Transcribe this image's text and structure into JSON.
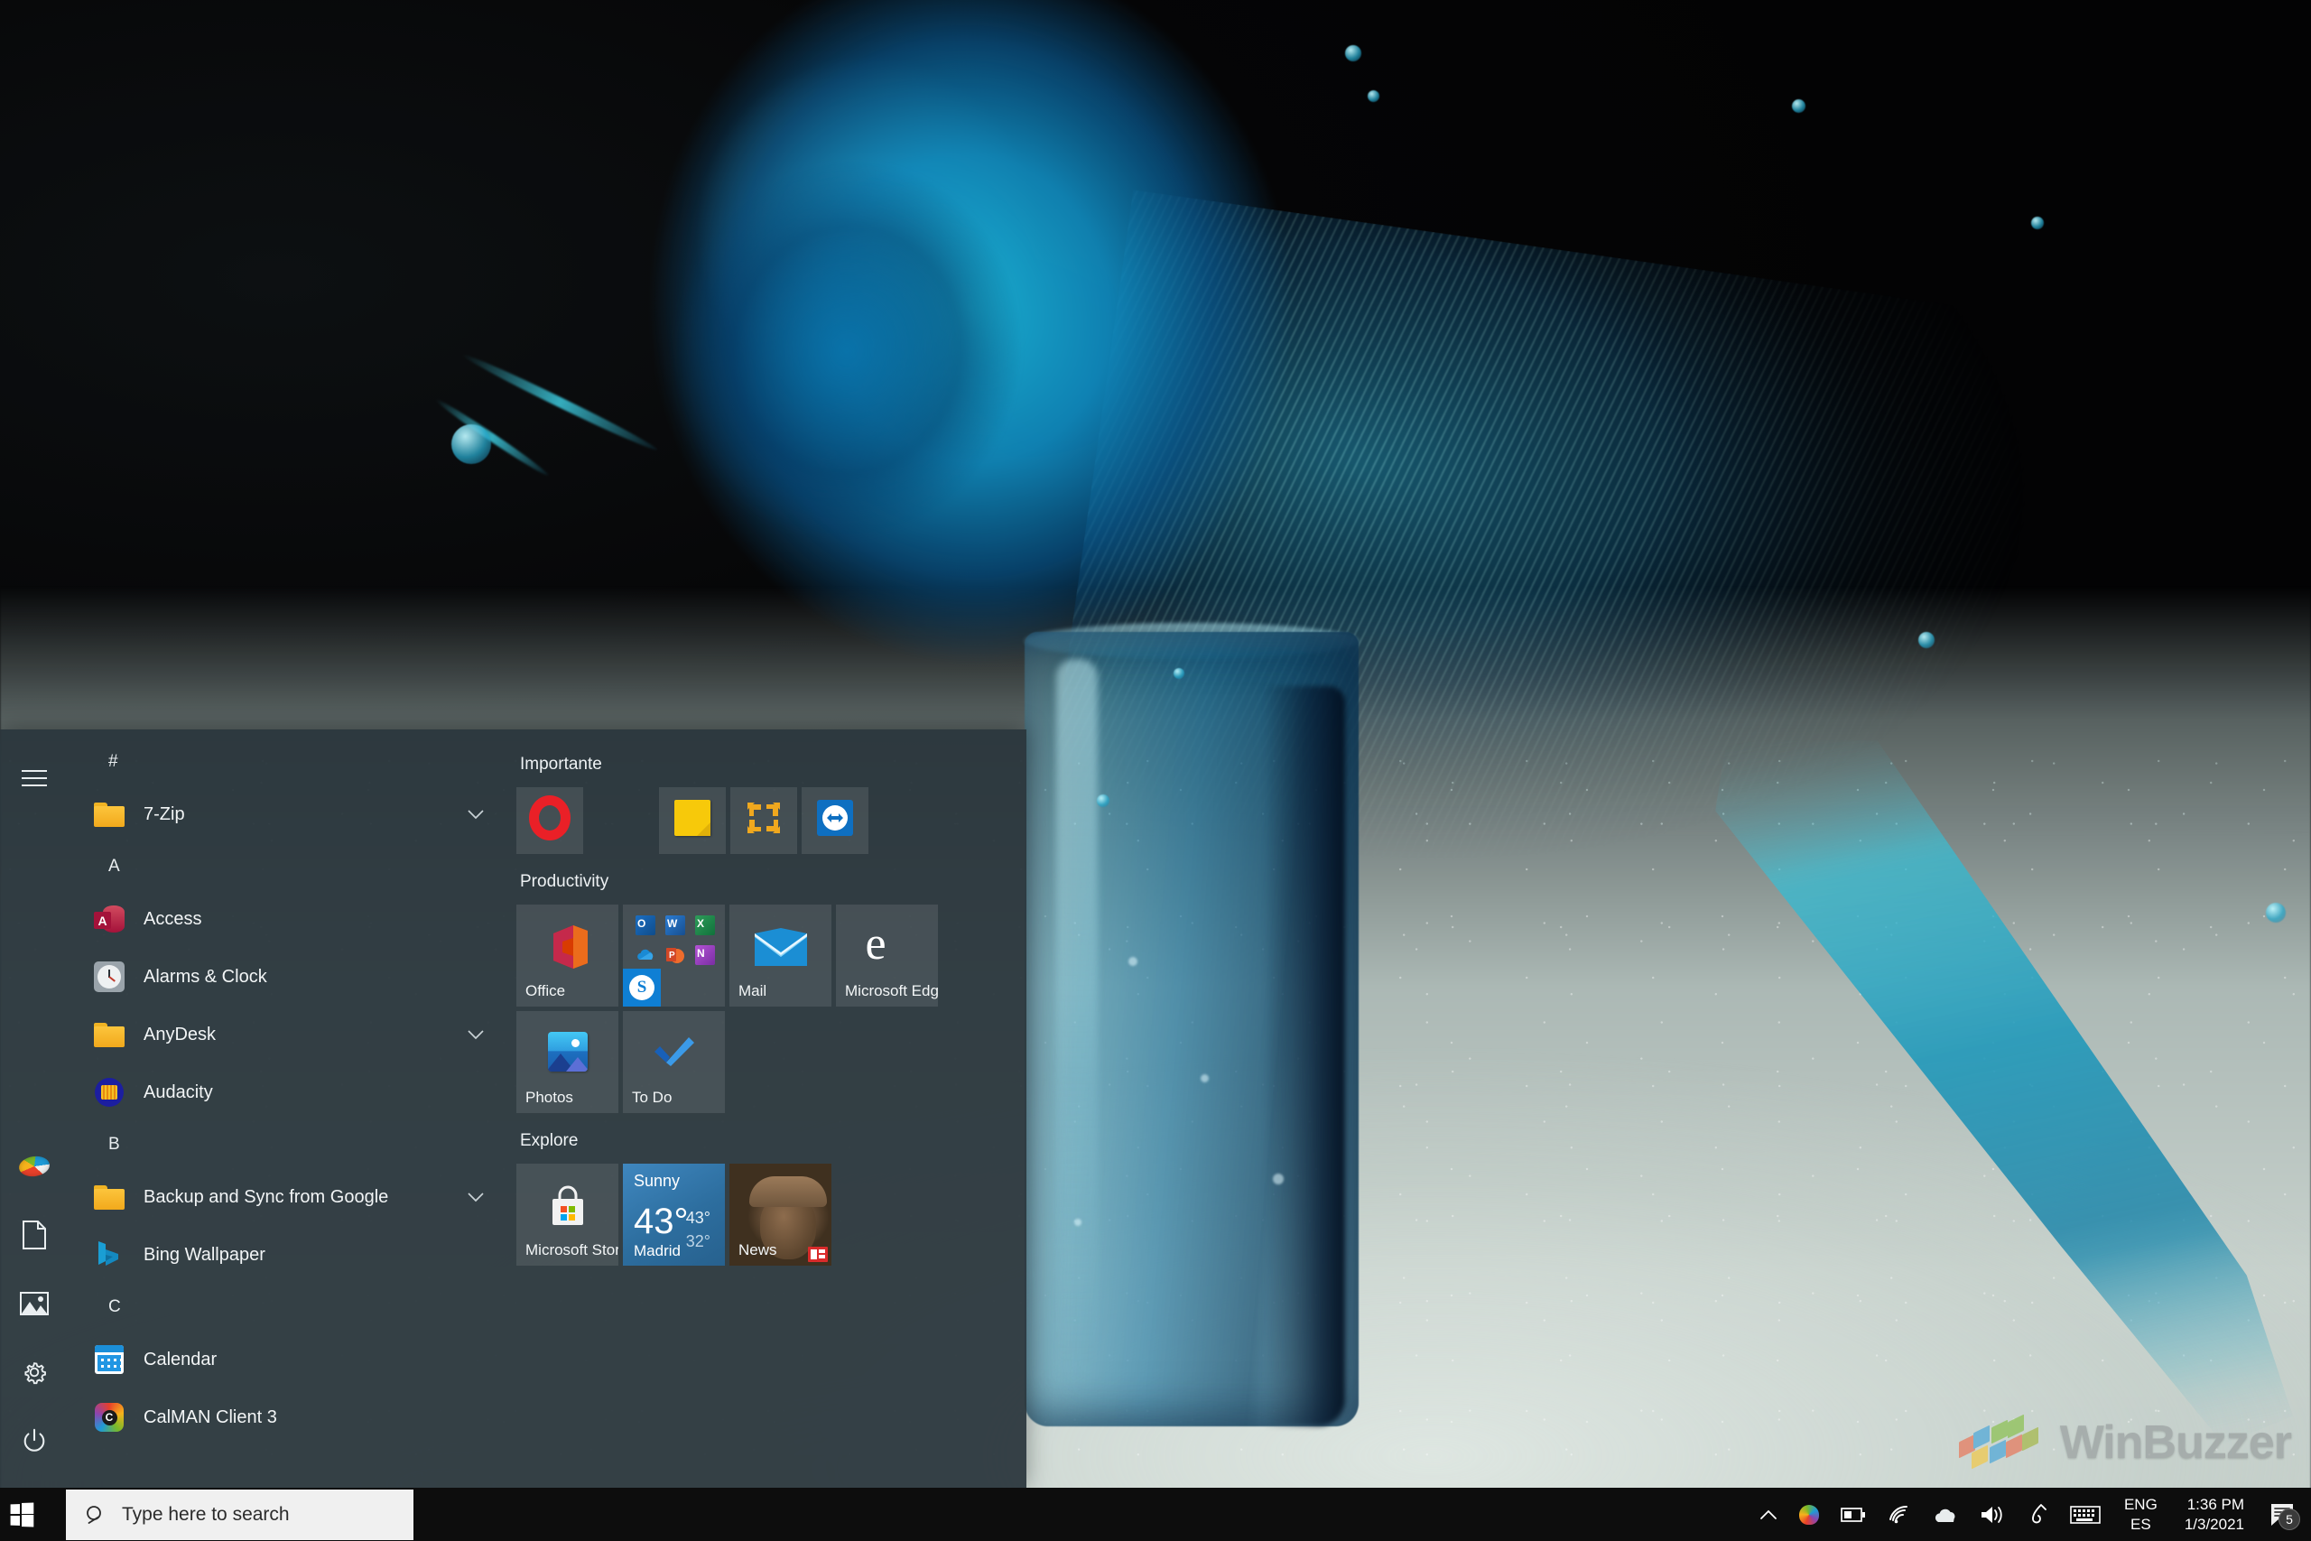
{
  "desktop": {
    "wallpaper_description": "Blue water splash over a glass on icy ground",
    "watermark": {
      "text": "WinBuzzer",
      "logo_icon": "winbuzzer-cubes-logo"
    }
  },
  "start_menu": {
    "rail": [
      {
        "label": "Expand",
        "icon": "hamburger-menu-icon",
        "name": "rail-hamburger"
      },
      {
        "label": "User account",
        "icon": "user-avatar-icon",
        "name": "rail-account"
      },
      {
        "label": "Documents",
        "icon": "documents-icon",
        "name": "rail-documents"
      },
      {
        "label": "Pictures",
        "icon": "pictures-icon",
        "name": "rail-pictures"
      },
      {
        "label": "Settings",
        "icon": "gear-icon",
        "name": "rail-settings"
      },
      {
        "label": "Power",
        "icon": "power-icon",
        "name": "rail-power"
      }
    ],
    "app_list": [
      {
        "type": "letter",
        "label": "#"
      },
      {
        "type": "app",
        "label": "7-Zip",
        "icon": "folder-icon",
        "expandable": true
      },
      {
        "type": "letter",
        "label": "A"
      },
      {
        "type": "app",
        "label": "Access",
        "icon": "access-icon",
        "expandable": false
      },
      {
        "type": "app",
        "label": "Alarms & Clock",
        "icon": "alarms-clock-icon",
        "expandable": false
      },
      {
        "type": "app",
        "label": "AnyDesk",
        "icon": "folder-icon",
        "expandable": true
      },
      {
        "type": "app",
        "label": "Audacity",
        "icon": "audacity-icon",
        "expandable": false
      },
      {
        "type": "letter",
        "label": "B"
      },
      {
        "type": "app",
        "label": "Backup and Sync from Google",
        "icon": "folder-icon",
        "expandable": true
      },
      {
        "type": "app",
        "label": "Bing Wallpaper",
        "icon": "bing-icon",
        "expandable": false
      },
      {
        "type": "letter",
        "label": "C"
      },
      {
        "type": "app",
        "label": "Calendar",
        "icon": "calendar-icon",
        "expandable": false
      },
      {
        "type": "app",
        "label": "CalMAN Client 3",
        "icon": "calman-icon",
        "expandable": false
      }
    ],
    "tile_groups": [
      {
        "title": "Importante",
        "tiles": [
          {
            "size": "sm",
            "icon": "opera-icon",
            "name": ""
          },
          {
            "size": "gap",
            "icon": "",
            "name": ""
          },
          {
            "size": "sm",
            "icon": "sticky-notes-icon",
            "name": ""
          },
          {
            "size": "sm",
            "icon": "vmware-icon",
            "name": ""
          },
          {
            "size": "sm",
            "icon": "teamviewer-icon",
            "name": ""
          }
        ]
      },
      {
        "title": "Productivity",
        "tiles": [
          {
            "size": "md",
            "icon": "office-icon",
            "name": "Office"
          },
          {
            "size": "md",
            "icon": "office-suite-group-icon",
            "name": ""
          },
          {
            "size": "md",
            "icon": "mail-icon",
            "name": "Mail"
          },
          {
            "size": "md",
            "icon": "microsoft-edge-icon",
            "name": "Microsoft Edge"
          },
          {
            "size": "md",
            "icon": "photos-icon",
            "name": "Photos"
          },
          {
            "size": "md",
            "icon": "todo-icon",
            "name": "To Do"
          }
        ]
      },
      {
        "title": "Explore",
        "tiles": [
          {
            "size": "md",
            "icon": "microsoft-store-icon",
            "name": "Microsoft Store"
          },
          {
            "size": "md",
            "icon": "weather-icon",
            "name": ""
          },
          {
            "size": "md",
            "icon": "news-icon",
            "name": "News"
          }
        ]
      }
    ],
    "office_mini_icons": [
      {
        "label": "O",
        "app": "Outlook",
        "class": "m-outlook"
      },
      {
        "label": "W",
        "app": "Word",
        "class": "m-word"
      },
      {
        "label": "X",
        "app": "Excel",
        "class": "m-excel"
      },
      {
        "label": "",
        "app": "OneDrive",
        "class": "m-onedrive"
      },
      {
        "label": "P",
        "app": "PowerPoint",
        "class": "m-ppt"
      },
      {
        "label": "N",
        "app": "OneNote",
        "class": "m-onenote"
      }
    ],
    "skype_label": "S",
    "weather_tile": {
      "condition": "Sunny",
      "temperature": "43°",
      "high": "43°",
      "low": "32°",
      "city": "Madrid"
    },
    "news_tile": {
      "label": "News"
    }
  },
  "taskbar": {
    "start_button": {
      "label": "Start",
      "icon": "windows-logo-icon"
    },
    "search": {
      "placeholder": "Type here to search",
      "value": "",
      "icon": "search-icon"
    },
    "tray": {
      "overflow": {
        "icon": "chevron-up-icon",
        "label": "Show hidden icons"
      },
      "icons": [
        {
          "icon": "calman-color-icon",
          "label": "CalMAN"
        },
        {
          "icon": "battery-icon",
          "label": "Battery"
        },
        {
          "icon": "wifi-icon",
          "label": "Network"
        },
        {
          "icon": "onedrive-cloud-icon",
          "label": "OneDrive"
        },
        {
          "icon": "volume-icon",
          "label": "Volume"
        },
        {
          "icon": "pen-icon",
          "label": "Windows Ink"
        },
        {
          "icon": "keyboard-icon",
          "label": "Touch keyboard"
        }
      ],
      "language": {
        "line1": "ENG",
        "line2": "ES"
      },
      "clock": {
        "time": "1:36 PM",
        "date": "1/3/2021"
      },
      "notifications": {
        "icon": "action-center-icon",
        "count": "5"
      }
    }
  },
  "colors": {
    "start_bg": "#2a363d",
    "tile_bg": "#4a5359",
    "taskbar_bg": "#0d0d0d",
    "search_bg": "#f0f0f0",
    "text": "#f2f5f6",
    "accent_blue": "#0f7fd4"
  }
}
